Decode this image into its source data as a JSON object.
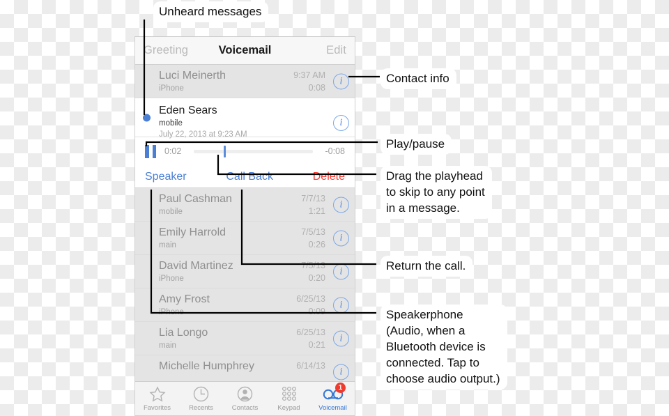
{
  "phone": {
    "navbar": {
      "left_label": "Greeting",
      "title": "Voicemail",
      "right_label": "Edit"
    },
    "messages": [
      {
        "name": "Luci Meinerth",
        "line": "iPhone",
        "date": "9:37 AM",
        "duration": "0:08",
        "unread": false,
        "selected": false
      },
      {
        "name": "Eden Sears",
        "line": "mobile",
        "date": "July 22, 2013 at 9:23 AM",
        "duration": "",
        "unread": true,
        "selected": true
      },
      {
        "name": "Paul Cashman",
        "line": "mobile",
        "date": "7/7/13",
        "duration": "1:21",
        "unread": false,
        "selected": false
      },
      {
        "name": "Emily Harrold",
        "line": "main",
        "date": "7/5/13",
        "duration": "0:26",
        "unread": false,
        "selected": false
      },
      {
        "name": "David Martinez",
        "line": "iPhone",
        "date": "7/5/13",
        "duration": "0:20",
        "unread": false,
        "selected": false
      },
      {
        "name": "Amy Frost",
        "line": "iPhone",
        "date": "6/25/13",
        "duration": "0:09",
        "unread": false,
        "selected": false
      },
      {
        "name": "Lia Longo",
        "line": "main",
        "date": "6/25/13",
        "duration": "0:21",
        "unread": false,
        "selected": false
      },
      {
        "name": "Michelle Humphrey",
        "line": "",
        "date": "6/14/13",
        "duration": "",
        "unread": false,
        "selected": false
      }
    ],
    "player": {
      "elapsed": "0:02",
      "remaining": "-0:08",
      "progress_percent": 25,
      "state": "playing"
    },
    "actions": {
      "speaker": "Speaker",
      "call_back": "Call Back",
      "delete": "Delete"
    },
    "tabbar": {
      "items": [
        {
          "label": "Favorites",
          "icon": "star-icon",
          "active": false,
          "badge": ""
        },
        {
          "label": "Recents",
          "icon": "clock-icon",
          "active": false,
          "badge": ""
        },
        {
          "label": "Contacts",
          "icon": "person-icon",
          "active": false,
          "badge": ""
        },
        {
          "label": "Keypad",
          "icon": "keypad-icon",
          "active": false,
          "badge": ""
        },
        {
          "label": "Voicemail",
          "icon": "voicemail-tape-icon",
          "active": true,
          "badge": "1"
        }
      ]
    }
  },
  "callouts": {
    "unheard": "Unheard messages",
    "contact_info": "Contact info",
    "play_pause": "Play/pause",
    "drag_playhead": "Drag the playhead\nto skip to any point\nin a message.",
    "return_call": "Return the call.",
    "speakerphone": "Speakerphone\n(Audio, when a\nBluetooth device is\nconnected. Tap to\nchoose audio output.)"
  },
  "colors": {
    "accent_blue": "#4a7fd4",
    "destructive_red": "#ff3b30",
    "badge_red": "#ef3b2d",
    "tab_active": "#3578d4",
    "row_dimmed": "#e4e4e4"
  }
}
